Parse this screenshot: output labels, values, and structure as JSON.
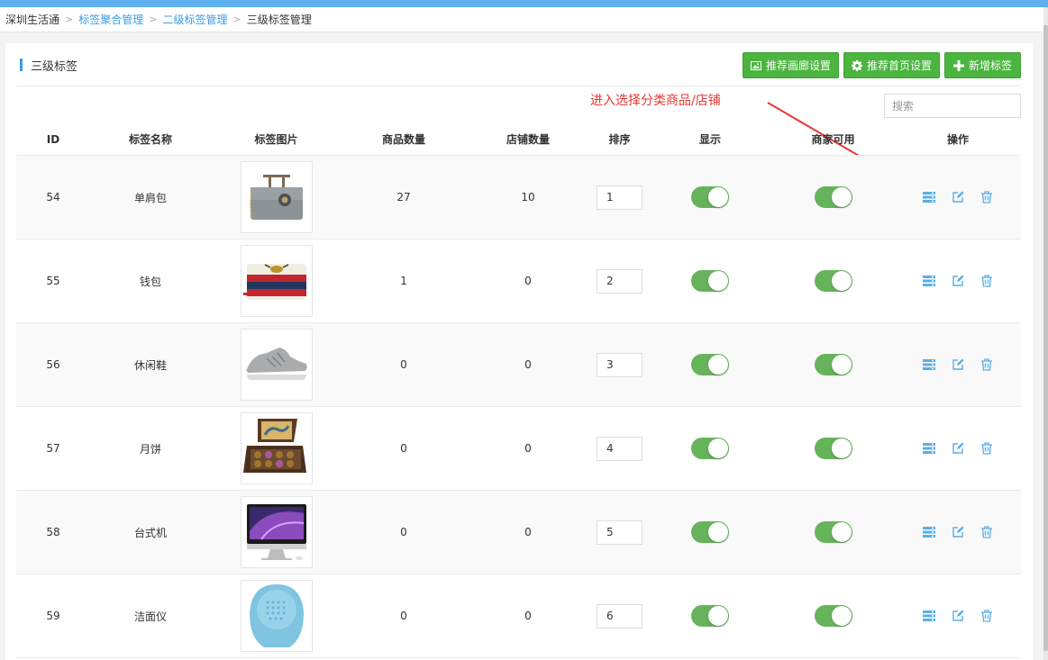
{
  "breadcrumb": {
    "items": [
      {
        "label": "深圳生活通",
        "link": false
      },
      {
        "label": "标签聚合管理",
        "link": true
      },
      {
        "label": "二级标签管理",
        "link": true
      },
      {
        "label": "三级标签管理",
        "link": false
      }
    ]
  },
  "panel": {
    "title": "三级标签",
    "buttons": [
      {
        "label": "推荐画廊设置",
        "icon": "image-icon"
      },
      {
        "label": "推荐首页设置",
        "icon": "gear-icon"
      },
      {
        "label": "新增标签",
        "icon": "plus-icon"
      }
    ],
    "search_placeholder": "搜索",
    "annotation": "进入选择分类商品/店铺"
  },
  "table": {
    "headers": [
      "ID",
      "标签名称",
      "标签图片",
      "商品数量",
      "店铺数量",
      "排序",
      "显示",
      "商家可用",
      "操作"
    ],
    "rows": [
      {
        "id": "54",
        "name": "单肩包",
        "image": "handbag",
        "goods": "27",
        "shops": "10",
        "sort": "1",
        "show": true,
        "merchant": true
      },
      {
        "id": "55",
        "name": "钱包",
        "image": "wallet",
        "goods": "1",
        "shops": "0",
        "sort": "2",
        "show": true,
        "merchant": true
      },
      {
        "id": "56",
        "name": "休闲鞋",
        "image": "sneaker",
        "goods": "0",
        "shops": "0",
        "sort": "3",
        "show": true,
        "merchant": true
      },
      {
        "id": "57",
        "name": "月饼",
        "image": "mooncake-box",
        "goods": "0",
        "shops": "0",
        "sort": "4",
        "show": true,
        "merchant": true
      },
      {
        "id": "58",
        "name": "台式机",
        "image": "desktop-computer",
        "goods": "0",
        "shops": "0",
        "sort": "5",
        "show": true,
        "merchant": true
      },
      {
        "id": "59",
        "name": "洁面仪",
        "image": "face-cleanser",
        "goods": "0",
        "shops": "0",
        "sort": "6",
        "show": true,
        "merchant": true
      }
    ],
    "row_actions": [
      "list-icon",
      "edit-icon",
      "trash-icon"
    ]
  },
  "colors": {
    "accent": "#3a9ee8",
    "button_green": "#4bb53f",
    "toggle_on": "#67b35c",
    "annotation_red": "#e53935"
  }
}
